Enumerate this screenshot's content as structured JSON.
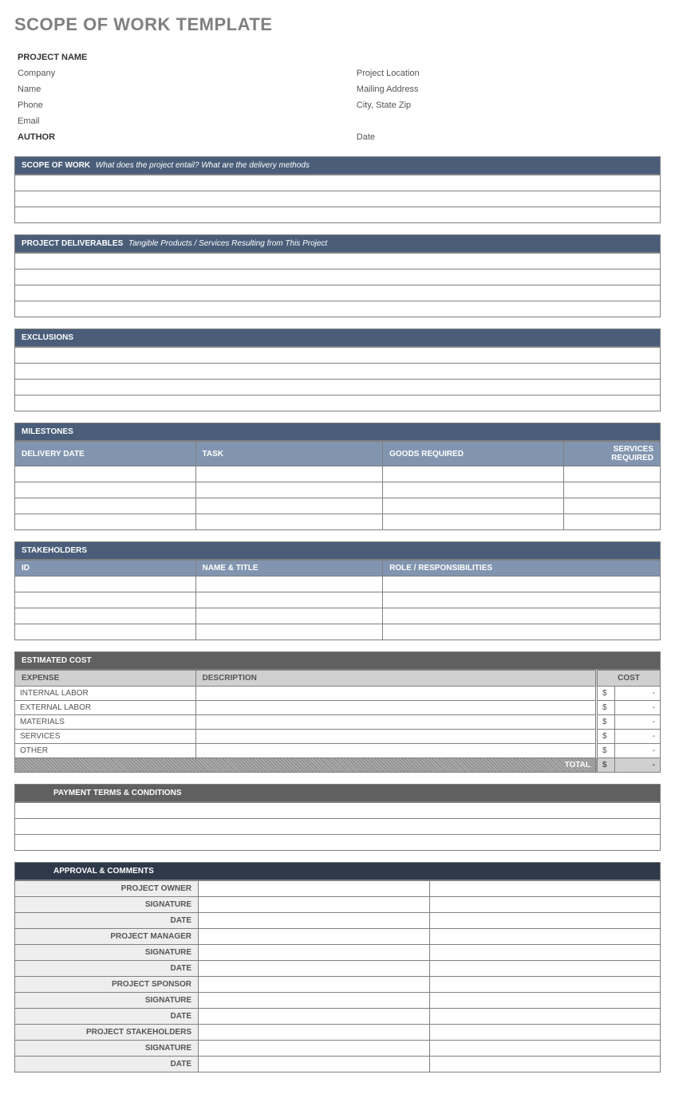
{
  "title": "SCOPE OF WORK TEMPLATE",
  "info": {
    "projectNameLabel": "PROJECT NAME",
    "leftLabels": [
      "Company",
      "Name",
      "Phone",
      "Email"
    ],
    "rightLabels": [
      "Project Location",
      "Mailing Address",
      "City, State Zip"
    ],
    "authorLabel": "AUTHOR",
    "dateLabel": "Date"
  },
  "scopeOfWork": {
    "header": "SCOPE OF WORK",
    "hint": "What does the project entail? What are the delivery methods"
  },
  "deliverables": {
    "header": "PROJECT DELIVERABLES",
    "hint": "Tangible Products / Services Resulting from This Project"
  },
  "exclusions": {
    "header": "EXCLUSIONS"
  },
  "milestones": {
    "header": "MILESTONES",
    "cols": [
      "DELIVERY DATE",
      "TASK",
      "GOODS REQUIRED",
      "SERVICES REQUIRED"
    ]
  },
  "stakeholders": {
    "header": "STAKEHOLDERS",
    "cols": [
      "ID",
      "NAME & TITLE",
      "ROLE / RESPONSIBILITIES"
    ]
  },
  "cost": {
    "header": "ESTIMATED COST",
    "cols": [
      "EXPENSE",
      "DESCRIPTION",
      "COST"
    ],
    "rows": [
      "INTERNAL LABOR",
      "EXTERNAL LABOR",
      "MATERIALS",
      "SERVICES",
      "OTHER"
    ],
    "currency": "$",
    "dash": "-",
    "totalLabel": "TOTAL"
  },
  "payment": {
    "header": "PAYMENT TERMS & CONDITIONS"
  },
  "approval": {
    "header": "APPROVAL & COMMENTS",
    "groups": [
      [
        "PROJECT OWNER",
        "SIGNATURE",
        "DATE"
      ],
      [
        "PROJECT MANAGER",
        "SIGNATURE",
        "DATE"
      ],
      [
        "PROJECT SPONSOR",
        "SIGNATURE",
        "DATE"
      ],
      [
        "PROJECT STAKEHOLDERS",
        "SIGNATURE",
        "DATE"
      ]
    ]
  }
}
